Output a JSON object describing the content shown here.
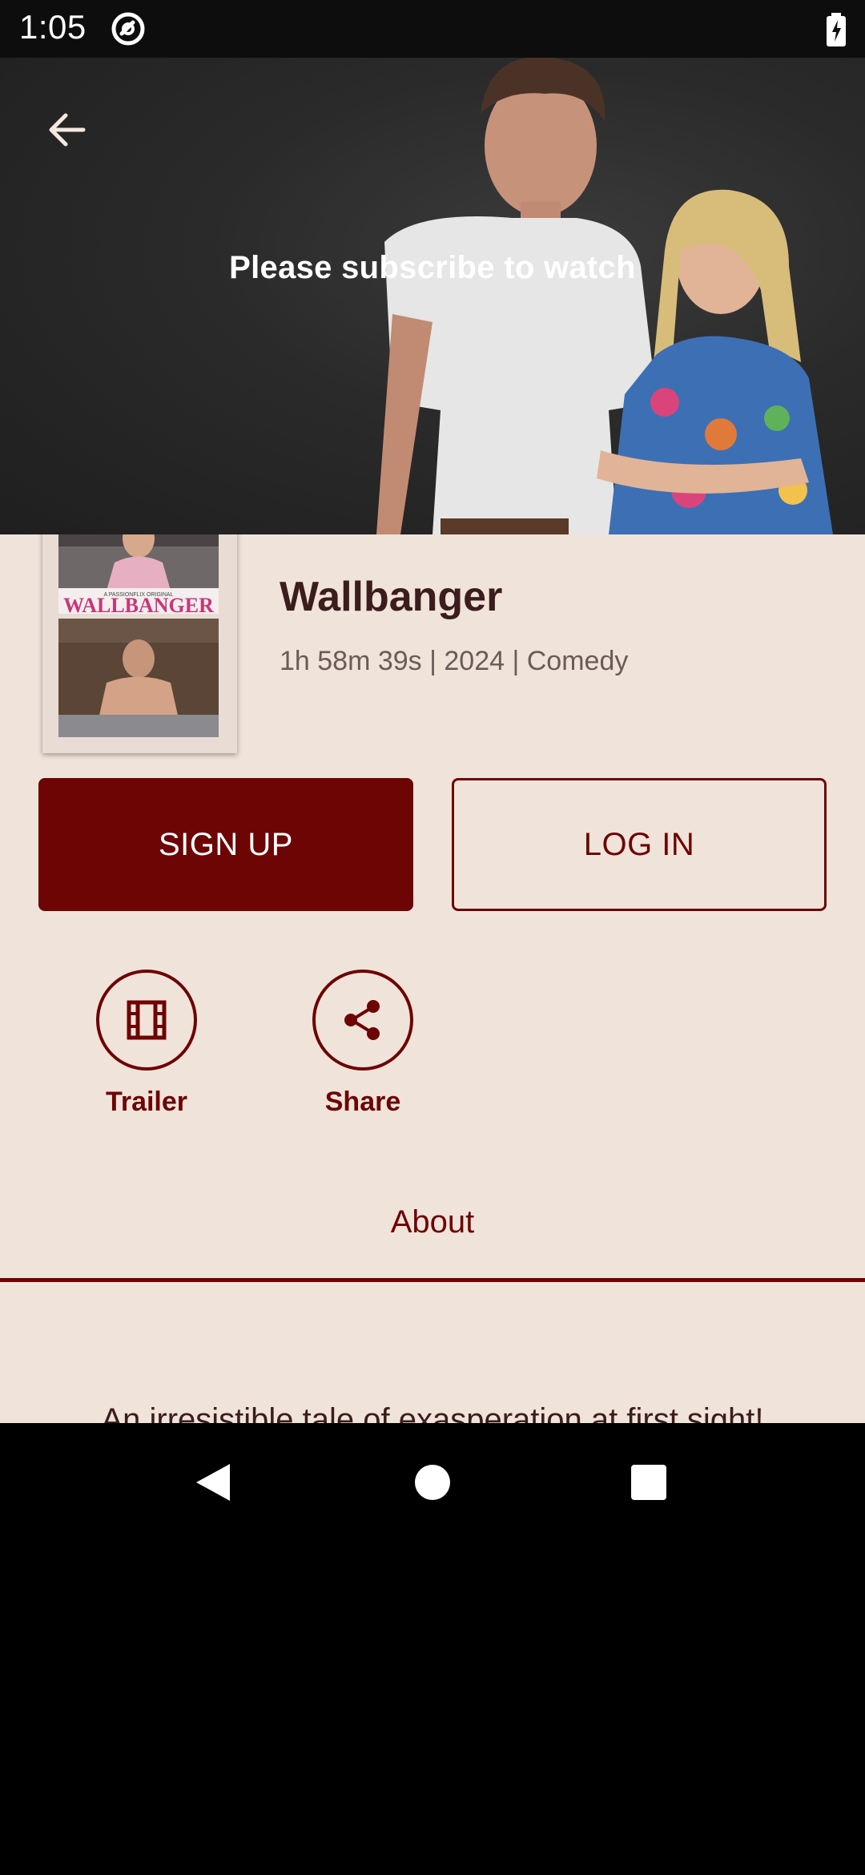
{
  "status_bar": {
    "time": "1:05"
  },
  "hero": {
    "message": "Please subscribe to watch"
  },
  "movie": {
    "title": "Wallbanger",
    "meta": "1h 58m 39s | 2024 | Comedy",
    "poster": {
      "tagline": "A PASSIONFLIX ORIGINAL",
      "title_art": "WALLBANGER"
    }
  },
  "buttons": {
    "signup": "SIGN UP",
    "login": "LOG IN"
  },
  "actions": {
    "trailer": "Trailer",
    "share": "Share"
  },
  "tabs": {
    "about": "About"
  },
  "about": {
    "description": "An irresistible tale of exasperation at first sight!"
  },
  "colors": {
    "accent": "#6d0505",
    "background": "#f0e3da",
    "text": "#3b1d1d"
  },
  "icons": [
    "arrow-left-icon",
    "film-icon",
    "share-icon",
    "nav-back-icon",
    "nav-home-icon",
    "nav-recent-icon"
  ]
}
